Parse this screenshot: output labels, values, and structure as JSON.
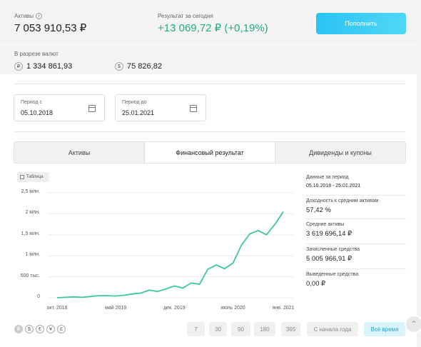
{
  "summary": {
    "assets_label": "Активы",
    "assets_value": "7 053 910,53 ₽",
    "today_label": "Результат за сегодня",
    "today_value": "+13 069,72 ₽ (+0,19%)",
    "topup_button": "Пополнить"
  },
  "currencies": {
    "label": "В разрезе валют",
    "items": [
      {
        "icon": "₽",
        "value": "1 334 861,93"
      },
      {
        "icon": "$",
        "value": "75 826,82"
      }
    ]
  },
  "period": {
    "from_label": "Период с",
    "from_value": "05.10.2018",
    "to_label": "Период до",
    "to_value": "25.01.2021"
  },
  "tabs": [
    {
      "label": "Активы",
      "active": false
    },
    {
      "label": "Финансовый результат",
      "active": true
    },
    {
      "label": "Дивиденды и купоны",
      "active": false
    }
  ],
  "table_button": "Таблица",
  "chart_data": {
    "type": "line",
    "title": "",
    "xlabel": "",
    "ylabel": "",
    "yticks": [
      "0",
      "500 тыс.",
      "1 млн.",
      "1,5 млн.",
      "2 млн.",
      "2,5 млн."
    ],
    "ytick_values": [
      0,
      500000,
      1000000,
      1500000,
      2000000,
      2500000
    ],
    "xticks": [
      "окт. 2018",
      "май 2019",
      "дек. 2019",
      "июль 2020",
      "янв. 2021"
    ],
    "xtick_values": [
      "2018-10",
      "2019-05",
      "2019-12",
      "2020-07",
      "2021-01"
    ],
    "ylim": [
      0,
      2500000
    ],
    "grid": true,
    "color": "#3cc79a",
    "series": [
      {
        "x": [
          "2018-10",
          "2018-11",
          "2018-12",
          "2019-01",
          "2019-02",
          "2019-03",
          "2019-04",
          "2019-05",
          "2019-06",
          "2019-07",
          "2019-08",
          "2019-09",
          "2019-10",
          "2019-11",
          "2019-12",
          "2020-01",
          "2020-02",
          "2020-03",
          "2020-04",
          "2020-05",
          "2020-06",
          "2020-07",
          "2020-08",
          "2020-09",
          "2020-10",
          "2020-11",
          "2020-12",
          "2021-01"
        ],
        "values": [
          0,
          10000,
          20000,
          10000,
          30000,
          50000,
          50000,
          40000,
          60000,
          90000,
          110000,
          180000,
          150000,
          210000,
          280000,
          230000,
          350000,
          320000,
          680000,
          780000,
          690000,
          830000,
          1250000,
          1520000,
          1600000,
          1500000,
          1750000,
          2050000
        ]
      }
    ]
  },
  "stats": [
    {
      "label": "Данные за период",
      "value": "05.10.2018 - 25.01.2021"
    },
    {
      "label": "Доходность к средним активам",
      "value": "57,42 %"
    },
    {
      "label": "Средние активы",
      "value": "3 619 696,14 ₽"
    },
    {
      "label": "Зачисленные средства",
      "value": "5 005 966,91 ₽"
    },
    {
      "label": "Выведенные средства",
      "value": "0,00 ₽"
    }
  ],
  "currency_switch": [
    "₽",
    "$",
    "€",
    "¥",
    "£"
  ],
  "periods": [
    "7",
    "30",
    "90",
    "180",
    "365",
    "С начала года",
    "Всё время"
  ]
}
